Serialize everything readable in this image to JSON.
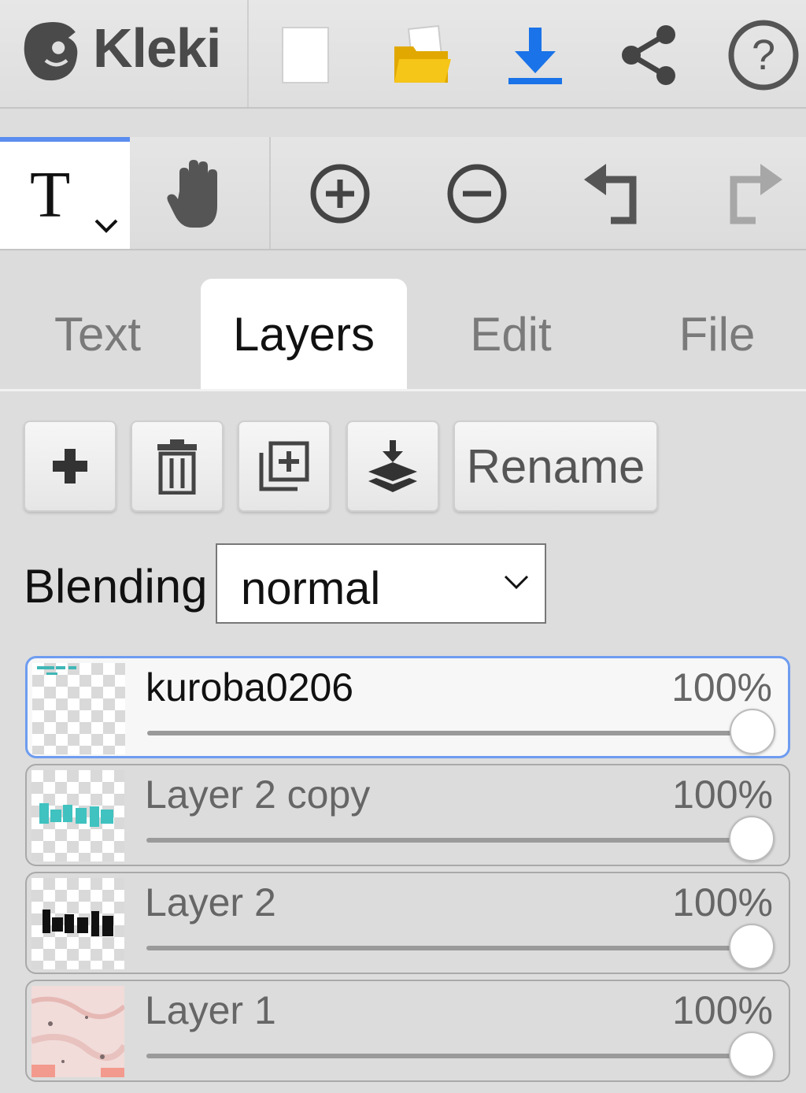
{
  "app": {
    "name": "Kleki"
  },
  "topbar": {
    "icons": [
      "new-image-icon",
      "open-folder-icon",
      "download-icon",
      "share-icon",
      "help-icon"
    ]
  },
  "toolrow": {
    "active_tool_glyph": "T",
    "icons": [
      "text-tool-icon",
      "hand-icon",
      "zoom-in-icon",
      "zoom-out-icon",
      "undo-icon",
      "redo-icon"
    ],
    "accent": "#5b8def"
  },
  "tabs": [
    {
      "label": "Text",
      "active": false
    },
    {
      "label": "Layers",
      "active": true
    },
    {
      "label": "Edit",
      "active": false
    },
    {
      "label": "File",
      "active": false
    }
  ],
  "layer_actions": {
    "icons": [
      "add-layer-icon",
      "delete-layer-icon",
      "duplicate-layer-icon",
      "merge-down-icon"
    ],
    "rename_label": "Rename"
  },
  "blending": {
    "label": "Blending",
    "value": "normal"
  },
  "layers": [
    {
      "name": "kuroba0206",
      "opacity_label": "100%",
      "opacity": 1.0,
      "active": true
    },
    {
      "name": "Layer 2 copy",
      "opacity_label": "100%",
      "opacity": 1.0,
      "active": false
    },
    {
      "name": "Layer 2",
      "opacity_label": "100%",
      "opacity": 1.0,
      "active": false
    },
    {
      "name": "Layer 1",
      "opacity_label": "100%",
      "opacity": 1.0,
      "active": false
    }
  ],
  "colors": {
    "download": "#1a73e8",
    "folder": "#f5c518",
    "selected_layer_border": "#6e9cf0"
  }
}
